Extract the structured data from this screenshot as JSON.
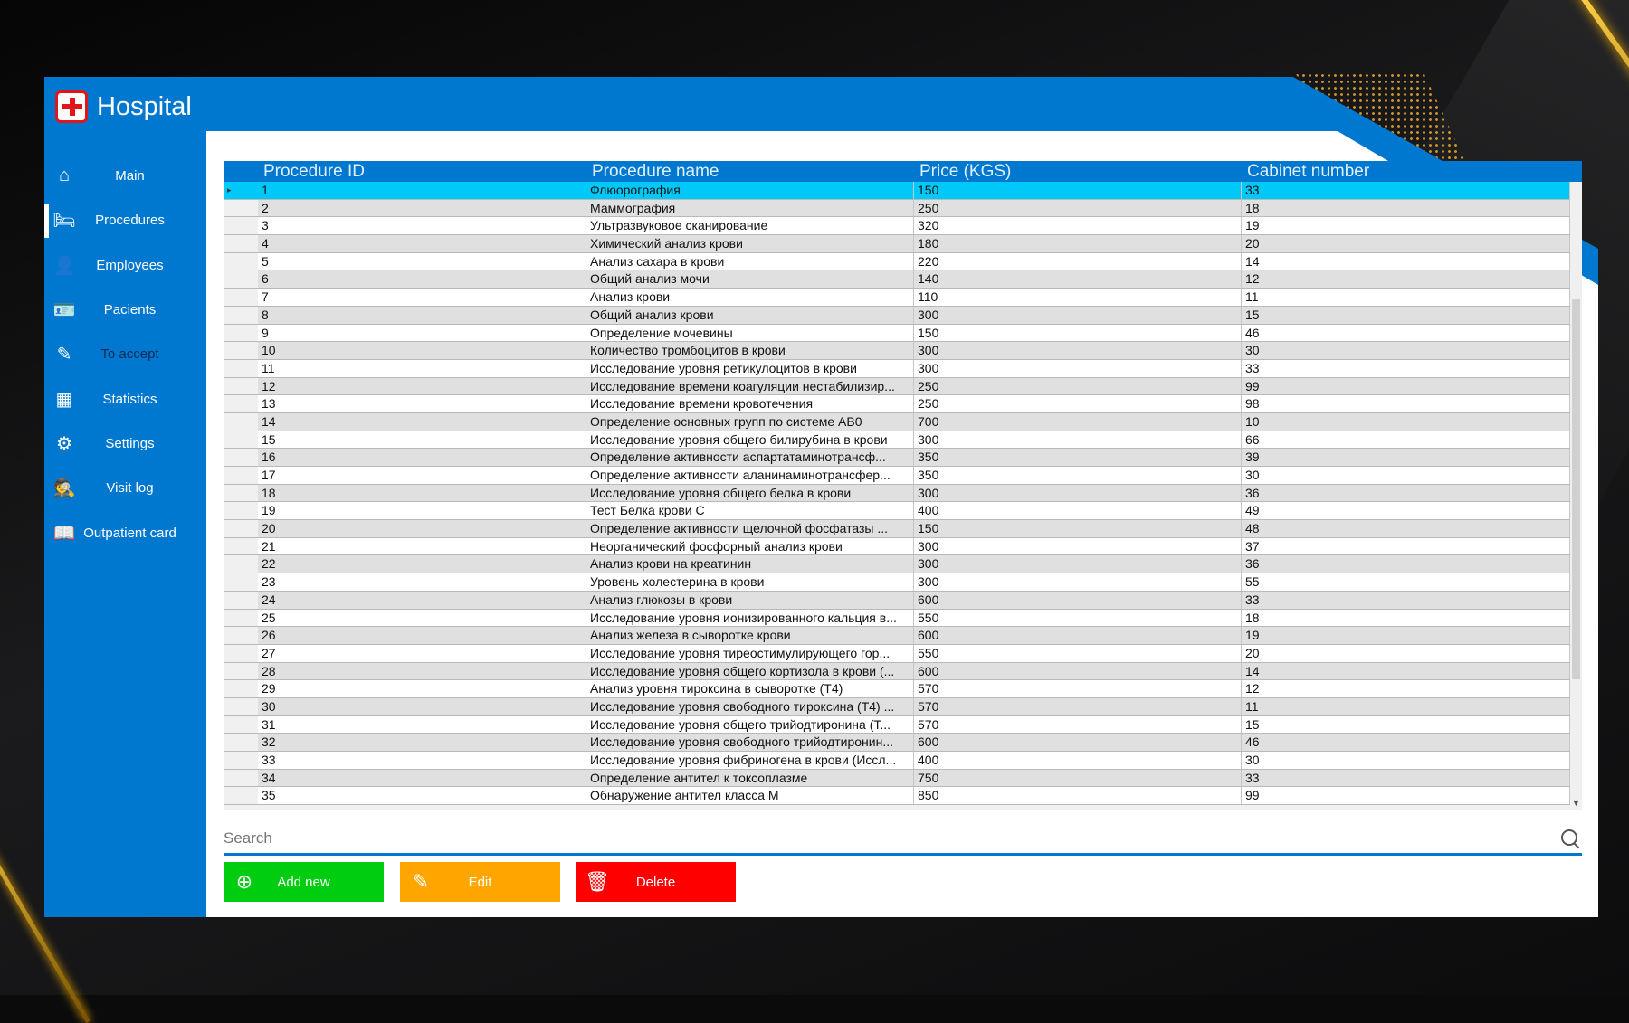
{
  "app": {
    "title": "Hospital"
  },
  "colors": {
    "primary": "#0078d0",
    "selected_row": "#00c8f8",
    "add": "#00cc10",
    "edit": "#ffa500",
    "delete": "#ff0000"
  },
  "sidebar": {
    "items": [
      {
        "label": "Main",
        "icon": "home-icon",
        "glyph": "⌂"
      },
      {
        "label": "Procedures",
        "icon": "hospital-bed-icon",
        "glyph": "🛏",
        "active": true
      },
      {
        "label": "Employees",
        "icon": "id-badge-icon",
        "glyph": "👤"
      },
      {
        "label": "Pacients",
        "icon": "id-card-icon",
        "glyph": "🪪"
      },
      {
        "label": "To accept",
        "icon": "edit-icon",
        "glyph": "✎",
        "dim": true
      },
      {
        "label": "Statistics",
        "icon": "bar-chart-icon",
        "glyph": "▦"
      },
      {
        "label": "Settings",
        "icon": "gears-icon",
        "glyph": "⚙"
      },
      {
        "label": "Visit log",
        "icon": "spy-icon",
        "glyph": "🕵"
      },
      {
        "label": "Outpatient card",
        "icon": "book-icon",
        "glyph": "📖"
      }
    ]
  },
  "table": {
    "columns": [
      "Procedure ID",
      "Procedure name",
      "Price (KGS)",
      "Cabinet number"
    ],
    "rows": [
      [
        "1",
        "Флюорография",
        "150",
        "33"
      ],
      [
        "2",
        "Маммография",
        "250",
        "18"
      ],
      [
        "3",
        "Ультразвуковое сканирование",
        "320",
        "19"
      ],
      [
        "4",
        "Химический анализ крови",
        "180",
        "20"
      ],
      [
        "5",
        "Анализ сахара в крови",
        "220",
        "14"
      ],
      [
        "6",
        "Общий анализ мочи",
        "140",
        "12"
      ],
      [
        "7",
        "Анализ крови",
        "110",
        "11"
      ],
      [
        "8",
        "Общий анализ крови",
        "300",
        "15"
      ],
      [
        "9",
        "Определение мочевины",
        "150",
        "46"
      ],
      [
        "10",
        "Количество тромбоцитов в крови",
        "300",
        "30"
      ],
      [
        "11",
        "Исследование уровня ретикулоцитов в крови",
        "300",
        "33"
      ],
      [
        "12",
        "Исследование времени коагуляции нестабилизир...",
        "250",
        "99"
      ],
      [
        "13",
        "Исследование времени кровотечения",
        "250",
        "98"
      ],
      [
        "14",
        "Определение основных групп по системе АВ0",
        "700",
        "10"
      ],
      [
        "15",
        "Исследование уровня общего билирубина в крови",
        "300",
        "66"
      ],
      [
        "16",
        "Определение активности аспартатаминотрансф...",
        "350",
        "39"
      ],
      [
        "17",
        "Определение активности аланинаминотрансфер...",
        "350",
        "30"
      ],
      [
        "18",
        "Исследование уровня общего белка в крови",
        "300",
        "36"
      ],
      [
        "19",
        "Тест Белка крови С",
        "400",
        "49"
      ],
      [
        "20",
        "Определение активности щелочной фосфатазы ...",
        "150",
        "48"
      ],
      [
        "21",
        "Неорганический фосфорный анализ крови",
        "300",
        "37"
      ],
      [
        "22",
        "Анализ крови на креатинин",
        "300",
        "36"
      ],
      [
        "23",
        "Уровень холестерина в крови",
        "300",
        "55"
      ],
      [
        "24",
        "Анализ глюкозы в крови",
        "600",
        "33"
      ],
      [
        "25",
        "Исследование уровня ионизированного кальция в...",
        "550",
        "18"
      ],
      [
        "26",
        "Анализ железа в сыворотке крови",
        "600",
        "19"
      ],
      [
        "27",
        "Исследование уровня тиреостимулирующего гор...",
        "550",
        "20"
      ],
      [
        "28",
        "Исследование уровня общего кортизола в крови (...",
        "600",
        "14"
      ],
      [
        "29",
        "Анализ уровня тироксина в сыворотке (Т4)",
        "570",
        "12"
      ],
      [
        "30",
        "Исследование уровня свободного тироксина (Т4) ...",
        "570",
        "11"
      ],
      [
        "31",
        "Исследование уровня общего трийодтиронина (Т...",
        "570",
        "15"
      ],
      [
        "32",
        "Исследование уровня свободного трийодтиронин...",
        "600",
        "46"
      ],
      [
        "33",
        "Исследование уровня фибриногена в крови (Иссл...",
        "400",
        "30"
      ],
      [
        "34",
        "Определение антител к токсоплазме",
        "750",
        "33"
      ],
      [
        "35",
        "Обнаружение антител класса М",
        "850",
        "99"
      ]
    ],
    "selected_row": 1
  },
  "search": {
    "placeholder": "Search",
    "value": ""
  },
  "actions": {
    "add": "Add new",
    "edit": "Edit",
    "delete": "Delete"
  }
}
